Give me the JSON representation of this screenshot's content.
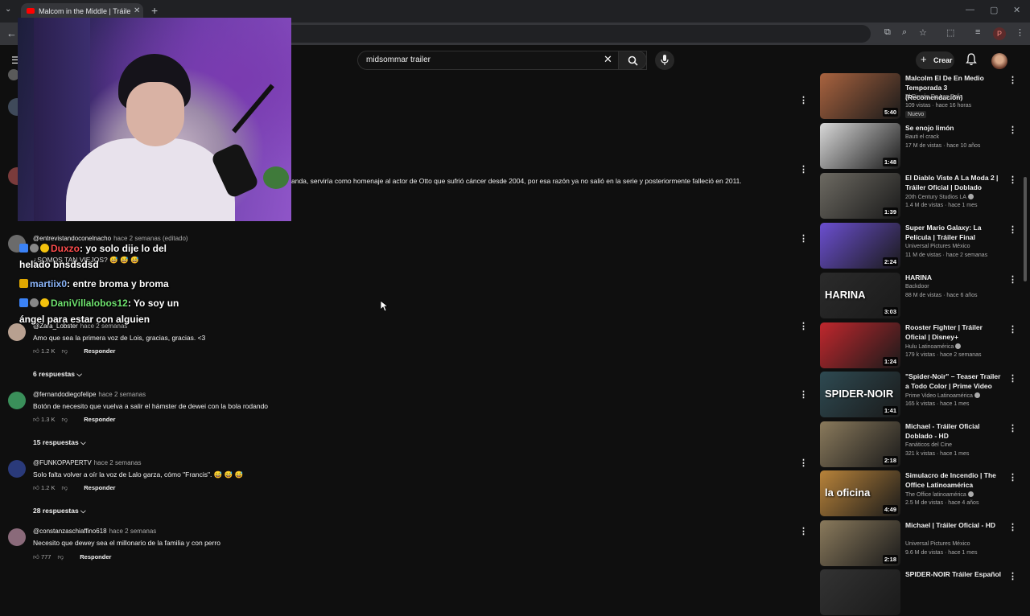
{
  "browser": {
    "tab_title": "Malcom in the Middle | Tráiler Oficial",
    "profile_initial": "P"
  },
  "youtube": {
    "search_value": "midsommar trailer",
    "create_label": "Crear"
  },
  "comments": {
    "truncated_text": "anda, serviría como homenaje al actor de Otto que sufrió cáncer desde 2004, por esa razón ya no salió en la serie y posteriormente falleció en 2011.",
    "items": [
      {
        "author": "@entrevistandoconelnacho",
        "time": "hace 2 semanas (editado)",
        "text": "¿SOMOS TAN VIEJOS? 😅 😅 😅"
      },
      {
        "author": "@Zara_Lobster",
        "time": "hace 2 semanas",
        "text": "Amo que sea la primera voz de Lois, gracias, gracias. <3",
        "likes": "1.2 K",
        "reply": "Responder",
        "replies": "6 respuestas"
      },
      {
        "author": "@fernandodiegofelipe",
        "time": "hace 2 semanas",
        "text": "Botón de necesito que vuelva a salir el hámster de dewei con la bola rodando",
        "likes": "1.3 K",
        "reply": "Responder",
        "replies": "15 respuestas"
      },
      {
        "author": "@FUNKOPAPERTV",
        "time": "hace 2 semanas",
        "text": "Solo falta volver a oír la voz de Lalo garza, cómo \"Francis\". 😅 😅 😅",
        "likes": "1.2 K",
        "reply": "Responder",
        "replies": "28 respuestas"
      },
      {
        "author": "@constanzaschiaffino618",
        "time": "hace 2 semanas",
        "text": "Necesito que dewey sea el millonario de la familia y con perro",
        "likes": "777",
        "reply": "Responder"
      }
    ]
  },
  "chat": [
    {
      "user": "Duxzo",
      "user_color": "#ff4d4d",
      "message": ": yo solo dije lo del",
      "message2": "helado bnsdsdsd"
    },
    {
      "user": "martiix0",
      "user_color": "#8ab4f8",
      "message": ": entre broma y broma"
    },
    {
      "user": "DaniVillalobos12",
      "user_color": "#6fe36f",
      "message": ": Yo soy un",
      "message2": "ángel para estar con alguien"
    }
  ],
  "sidebar": [
    {
      "title": "Malcolm El De En Medio Temporada 3 (Recomendación)",
      "channel": "El Rincón De Las Pelis",
      "meta": "109 vistas · hace 16 horas",
      "duration": "5:40",
      "badge": "Nuevo",
      "thumb_color": "#a9633f"
    },
    {
      "title": "Se enojo limón",
      "channel": "Bauti el crack",
      "meta": "17 M de vistas · hace 10 años",
      "duration": "1:48",
      "thumb_color": "#d8d8d8"
    },
    {
      "title": "El Diablo Viste A La Moda 2 | Tráiler Oficial | Doblado",
      "channel": "20th Century Studios LA",
      "meta": "1.4 M de vistas · hace 1 mes",
      "duration": "1:39",
      "verified": true,
      "thumb_color": "#6d6a62"
    },
    {
      "title": "Super Mario Galaxy: La Película | Tráiler Final",
      "channel": "Universal Pictures México",
      "meta": "11 M de vistas · hace 2 semanas",
      "duration": "2:24",
      "thumb_color": "#6b4fd0"
    },
    {
      "title": "HARINA",
      "channel": "Backdoor",
      "meta": "88 M de vistas · hace 6 años",
      "duration": "3:03",
      "thumb_color": "#2b2b2b",
      "thumb_text": "HARINA"
    },
    {
      "title": "Rooster Fighter | Tráiler Oficial | Disney+",
      "channel": "Hulu Latinoamérica",
      "meta": "179 k vistas · hace 2 semanas",
      "duration": "1:24",
      "verified": true,
      "thumb_color": "#c0272d"
    },
    {
      "title": "\"Spider-Noir\" – Teaser Trailer a Todo Color | Prime Video",
      "channel": "Prime Video Latinoamérica",
      "meta": "165 k vistas · hace 1 mes",
      "duration": "1:41",
      "verified": true,
      "thumb_color": "#2e4a52",
      "thumb_text": "SPIDER-NOIR"
    },
    {
      "title": "Michael - Tráiler Oficial Doblado - HD",
      "channel": "Fanáticos del Cine",
      "meta": "321 k vistas · hace 1 mes",
      "duration": "2:18",
      "thumb_color": "#8a7a5c"
    },
    {
      "title": "Simulacro de Incendio | The Office Latinoamérica",
      "channel": "The Office latinoamérica",
      "meta": "2.5 M de vistas · hace 4 años",
      "duration": "4:49",
      "verified": true,
      "thumb_color": "#b8833a",
      "thumb_text": "la oficina"
    },
    {
      "title": "Michael | Tráiler Oficial - HD",
      "channel": "Universal Pictures México",
      "meta": "9.6 M de vistas · hace 1 mes",
      "duration": "2:18",
      "thumb_color": "#8a7a5c"
    },
    {
      "title": "SPIDER-NOIR Tráiler Español",
      "thumb_color": "#333"
    }
  ]
}
